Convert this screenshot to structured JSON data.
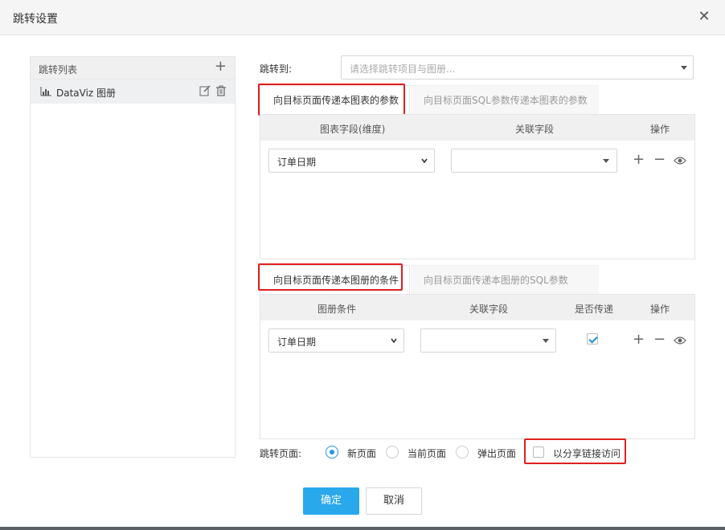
{
  "dialog": {
    "title": "跳转设置",
    "close_icon": "close-icon"
  },
  "left": {
    "header": "跳转列表",
    "items": [
      {
        "label": "DataViz 图册",
        "icon": "bar-chart-icon"
      }
    ]
  },
  "target": {
    "label": "跳转到:",
    "placeholder": "请选择跳转项目与图册..."
  },
  "chart_tabs": [
    {
      "label": "向目标页面传递本图表的参数",
      "active": true
    },
    {
      "label": "向目标页面SQL参数传递本图表的参数",
      "active": false
    }
  ],
  "chart_table": {
    "headers": {
      "field": "图表字段(维度)",
      "link": "关联字段",
      "ops": "操作"
    },
    "row": {
      "field": "订单日期",
      "link": ""
    }
  },
  "book_tabs": [
    {
      "label": "向目标页面传递本图册的条件",
      "active": true
    },
    {
      "label": "向目标页面传递本图册的SQL参数",
      "active": false
    }
  ],
  "book_table": {
    "headers": {
      "cond": "图册条件",
      "link": "关联字段",
      "pass": "是否传递",
      "ops": "操作"
    },
    "row": {
      "cond": "订单日期",
      "link": "",
      "pass": true
    }
  },
  "page_mode": {
    "label": "跳转页面:",
    "options": [
      "新页面",
      "当前页面",
      "弹出页面"
    ],
    "selected": "新页面",
    "share_label": "以分享链接访问"
  },
  "buttons": {
    "ok": "确定",
    "cancel": "取消"
  },
  "colors": {
    "accent": "#29a8ec",
    "highlight": "#e02020"
  }
}
